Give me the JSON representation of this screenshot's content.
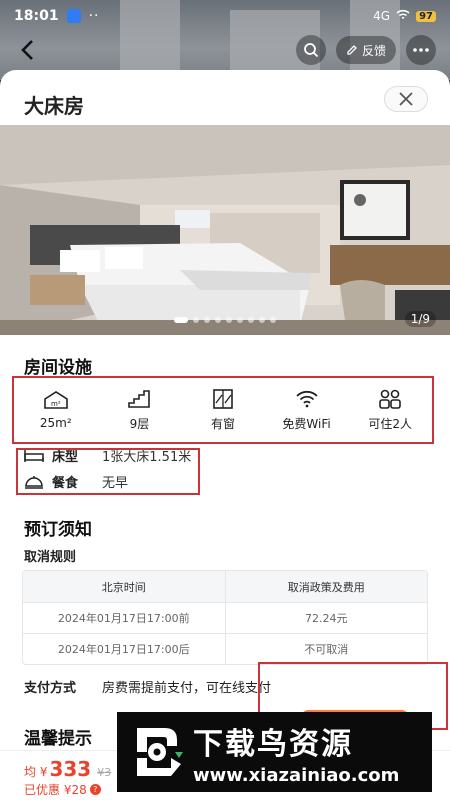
{
  "status_bar": {
    "time": "18:01",
    "dots": "··",
    "signal": "4G",
    "battery": "97"
  },
  "nav": {
    "feedback_label": "反馈"
  },
  "sheet": {
    "title": "大床房"
  },
  "gallery": {
    "counter": "1/9",
    "total_dots": 9,
    "active_dot": 1
  },
  "facilities": {
    "title": "房间设施",
    "items": [
      {
        "icon": "area-icon",
        "label": "25m²"
      },
      {
        "icon": "stairs-icon",
        "label": "9层"
      },
      {
        "icon": "window-icon",
        "label": "有窗"
      },
      {
        "icon": "wifi-icon",
        "label": "免费WiFi"
      },
      {
        "icon": "people-icon",
        "label": "可住2人"
      }
    ],
    "bed": {
      "key": "床型",
      "value": "1张大床1.51米"
    },
    "meal": {
      "key": "餐食",
      "value": "无早"
    }
  },
  "booking_notice": {
    "title": "预订须知",
    "cancel_title": "取消规则",
    "table": {
      "headers": [
        "北京时间",
        "取消政策及费用"
      ],
      "rows": [
        [
          "2024年01月17日17:00前",
          "72.24元"
        ],
        [
          "2024年01月17日17:00后",
          "不可取消"
        ]
      ]
    },
    "payment": {
      "key": "支付方式",
      "value": "房费需提前支付，可在线支付"
    }
  },
  "tips": {
    "title": "温馨提示"
  },
  "bottom": {
    "price_prefix": "均 ¥",
    "price": "333",
    "original_price": "¥3",
    "discount": "已优惠 ¥28",
    "qmark": "?"
  },
  "watermark": {
    "title": "下载鸟资源",
    "url": "www.xiazainiao.com"
  },
  "colors": {
    "accent": "#e8432c",
    "highlight_box": "#c9343a"
  }
}
